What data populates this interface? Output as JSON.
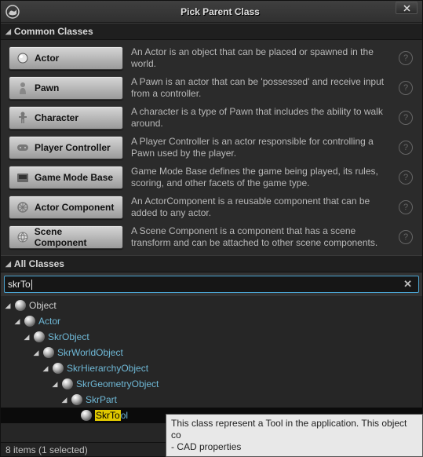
{
  "window": {
    "title": "Pick Parent Class"
  },
  "sections": {
    "common": "Common Classes",
    "all": "All Classes"
  },
  "classes": [
    {
      "label": "Actor",
      "desc": "An Actor is an object that can be placed or spawned in the world."
    },
    {
      "label": "Pawn",
      "desc": "A Pawn is an actor that can be 'possessed' and receive input from a controller."
    },
    {
      "label": "Character",
      "desc": "A character is a type of Pawn that includes the ability to walk around."
    },
    {
      "label": "Player Controller",
      "desc": "A Player Controller is an actor responsible for controlling a Pawn used by the player."
    },
    {
      "label": "Game Mode Base",
      "desc": "Game Mode Base defines the game being played, its rules, scoring, and other facets of the game type."
    },
    {
      "label": "Actor Component",
      "desc": "An ActorComponent is a reusable component that can be added to any actor."
    },
    {
      "label": "Scene Component",
      "desc": "A Scene Component is a component that has a scene transform and can be attached to other scene components."
    }
  ],
  "search": {
    "value": "skrTo"
  },
  "tree": [
    {
      "indent": 0,
      "label": "Object",
      "link": false,
      "selected": false,
      "match": ""
    },
    {
      "indent": 1,
      "label": "Actor",
      "link": true,
      "selected": false,
      "match": ""
    },
    {
      "indent": 2,
      "label": "SkrObject",
      "link": true,
      "selected": false,
      "match": ""
    },
    {
      "indent": 3,
      "label": "SkrWorldObject",
      "link": true,
      "selected": false,
      "match": ""
    },
    {
      "indent": 4,
      "label": "SkrHierarchyObject",
      "link": true,
      "selected": false,
      "match": ""
    },
    {
      "indent": 5,
      "label": "SkrGeometryObject",
      "link": true,
      "selected": false,
      "match": ""
    },
    {
      "indent": 6,
      "label": "SkrPart",
      "link": true,
      "selected": false,
      "match": ""
    },
    {
      "indent": 7,
      "label": "SkrTool",
      "link": true,
      "selected": true,
      "match": "SkrTo",
      "rest": "ol"
    }
  ],
  "status": "8 items (1 selected)",
  "tooltip": {
    "line1": "This class represent a Tool in the application. This object co",
    "line2": "- CAD properties"
  }
}
